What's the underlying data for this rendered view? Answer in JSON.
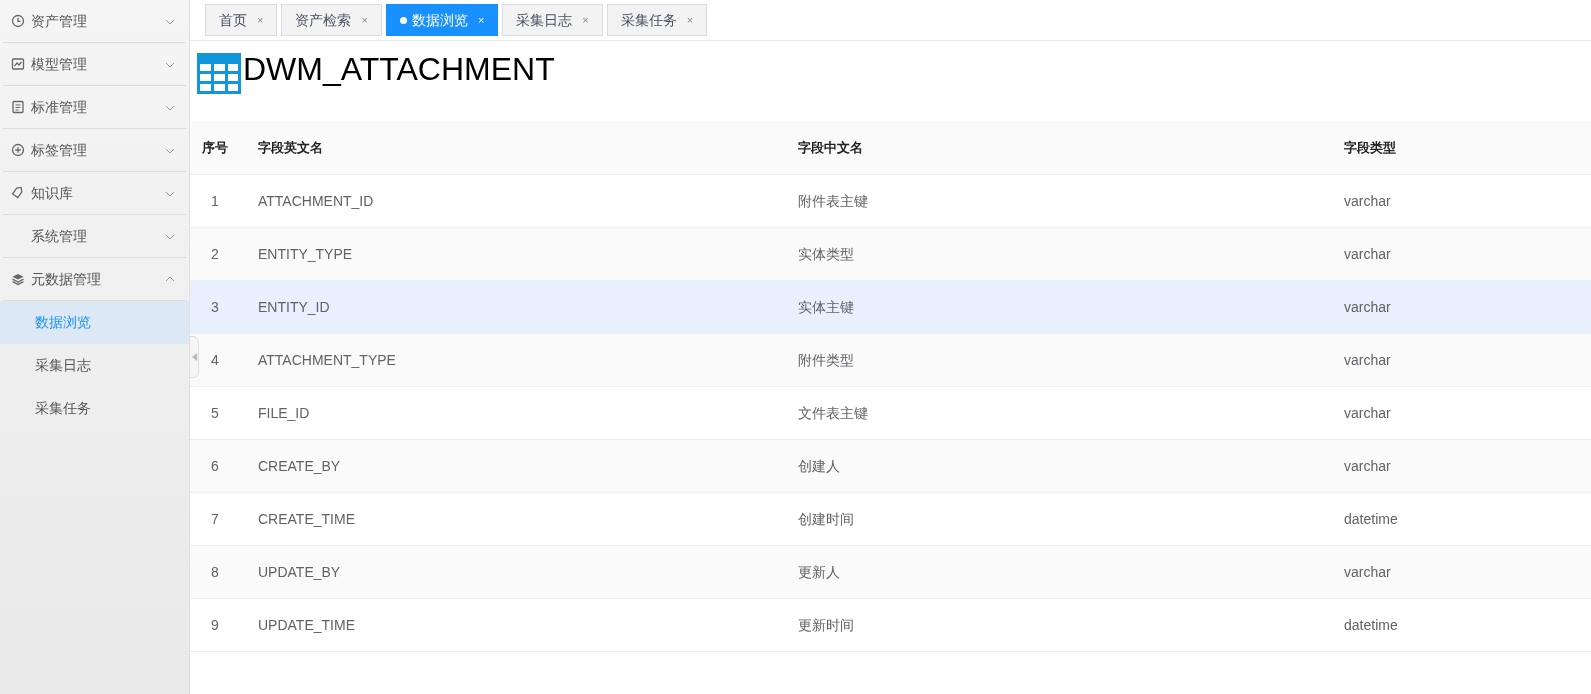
{
  "sidebar": {
    "items": [
      {
        "label": "资产管理",
        "expanded": false
      },
      {
        "label": "模型管理",
        "expanded": false
      },
      {
        "label": "标准管理",
        "expanded": false
      },
      {
        "label": "标签管理",
        "expanded": false
      },
      {
        "label": "知识库",
        "expanded": false
      },
      {
        "label": "系统管理",
        "expanded": false
      },
      {
        "label": "元数据管理",
        "expanded": true,
        "children": [
          {
            "label": "数据浏览",
            "selected": true
          },
          {
            "label": "采集日志",
            "selected": false
          },
          {
            "label": "采集任务",
            "selected": false
          }
        ]
      }
    ]
  },
  "tabs": [
    {
      "label": "首页",
      "close": "×",
      "selected": false
    },
    {
      "label": "资产检索",
      "close": "×",
      "selected": false
    },
    {
      "label": "数据浏览",
      "close": "×",
      "selected": true
    },
    {
      "label": "采集日志",
      "close": "×",
      "selected": false
    },
    {
      "label": "采集任务",
      "close": "×",
      "selected": false
    }
  ],
  "title": "DWM_ATTACHMENT",
  "table": {
    "columns": [
      "序号",
      "字段英文名",
      "字段中文名",
      "字段类型"
    ],
    "rows": [
      {
        "cells": [
          "1",
          "ATTACHMENT_ID",
          "附件表主键",
          "varchar"
        ],
        "selected": false
      },
      {
        "cells": [
          "2",
          "ENTITY_TYPE",
          "实体类型",
          "varchar"
        ],
        "selected": false
      },
      {
        "cells": [
          "3",
          "ENTITY_ID",
          "实体主键",
          "varchar"
        ],
        "selected": true
      },
      {
        "cells": [
          "4",
          "ATTACHMENT_TYPE",
          "附件类型",
          "varchar"
        ],
        "selected": false
      },
      {
        "cells": [
          "5",
          "FILE_ID",
          "文件表主键",
          "varchar"
        ],
        "selected": false
      },
      {
        "cells": [
          "6",
          "CREATE_BY",
          "创建人",
          "varchar"
        ],
        "selected": false
      },
      {
        "cells": [
          "7",
          "CREATE_TIME",
          "创建时间",
          "datetime"
        ],
        "selected": false
      },
      {
        "cells": [
          "8",
          "UPDATE_BY",
          "更新人",
          "varchar"
        ],
        "selected": false
      },
      {
        "cells": [
          "9",
          "UPDATE_TIME",
          "更新时间",
          "datetime"
        ],
        "selected": false
      }
    ]
  }
}
